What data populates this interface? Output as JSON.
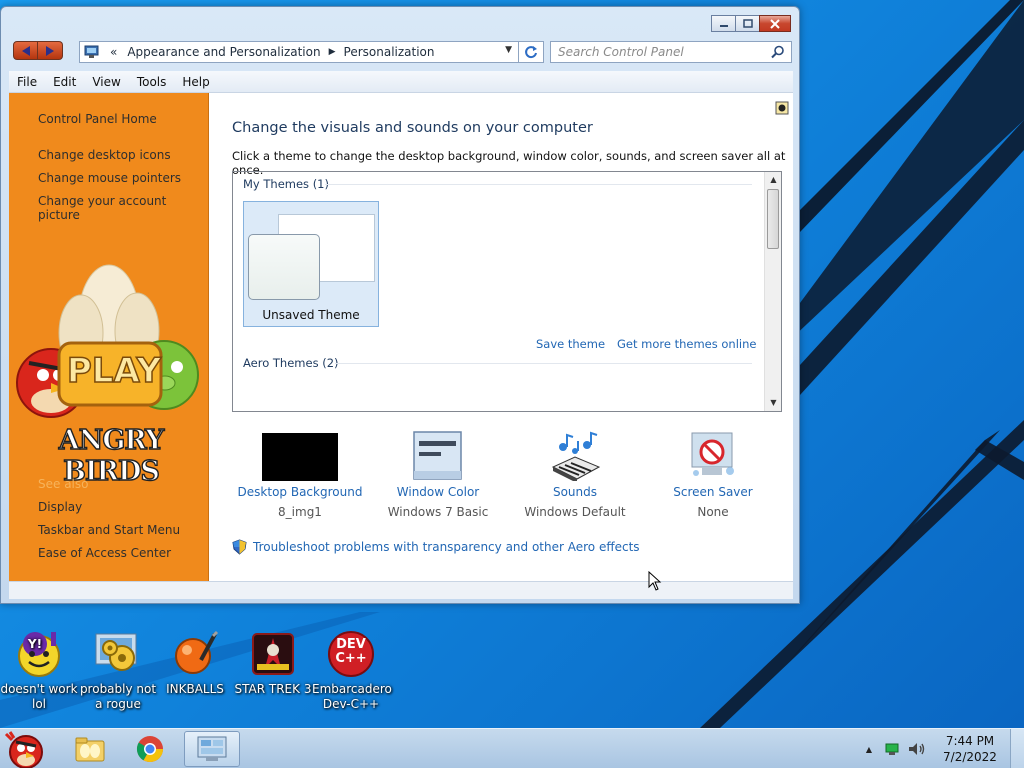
{
  "window": {
    "address": {
      "root_glyph": "«",
      "crumbs": [
        "Appearance and Personalization",
        "Personalization"
      ]
    },
    "search": {
      "placeholder": "Search Control Panel"
    },
    "menu": [
      "File",
      "Edit",
      "View",
      "Tools",
      "Help"
    ],
    "sidebar": {
      "home": "Control Panel Home",
      "links": [
        "Change desktop icons",
        "Change mouse pointers",
        "Change your account picture"
      ],
      "banner_play": "PLAY",
      "banner_title": "ANGRY BIRDS",
      "see_also_label": "See also",
      "see_also": [
        "Display",
        "Taskbar and Start Menu",
        "Ease of Access Center"
      ]
    },
    "content": {
      "title": "Change the visuals and sounds on your computer",
      "description": "Click a theme to change the desktop background, window color, sounds, and screen saver all at once.",
      "my_themes_header": "My Themes (1)",
      "aero_themes_header": "Aero Themes (2)",
      "unsaved_theme": "Unsaved Theme",
      "save_theme": "Save theme",
      "get_more": "Get more themes online",
      "options": [
        {
          "label": "Desktop Background",
          "value": "8_img1"
        },
        {
          "label": "Window Color",
          "value": "Windows 7 Basic"
        },
        {
          "label": "Sounds",
          "value": "Windows Default"
        },
        {
          "label": "Screen Saver",
          "value": "None"
        }
      ],
      "troubleshoot": "Troubleshoot problems with transparency and other Aero effects"
    }
  },
  "desktop_icons": [
    {
      "label": "doesn't work lol"
    },
    {
      "label": "probably not a rogue"
    },
    {
      "label": "INKBALLS"
    },
    {
      "label": "STAR TREK 3"
    },
    {
      "label": "Embarcadero Dev-C++"
    }
  ],
  "icon_text": {
    "devcpp": "DEV C++",
    "yahoo": "Y!"
  },
  "taskbar": {
    "time": "7:44 PM",
    "date": "7/2/2022",
    "tray_arrow": "▲"
  },
  "colors": {
    "sidebar": "#f08a1c",
    "link": "#2267b4",
    "desktop": "#1a8fe8"
  }
}
